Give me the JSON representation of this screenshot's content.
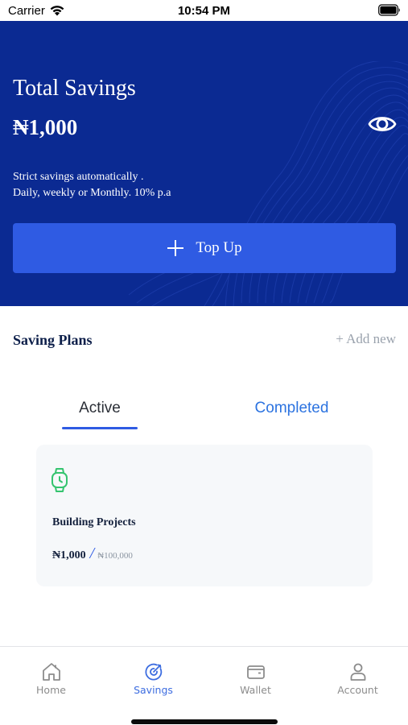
{
  "status_bar": {
    "carrier": "Carrier",
    "time": "10:54 PM",
    "wifi_icon": "wifi-icon",
    "battery_icon": "battery-full-icon"
  },
  "hero": {
    "title": "Total Savings",
    "amount": "₦1,000",
    "description_line1": "Strict savings automatically .",
    "description_line2": "Daily, weekly or Monthly. 10% p.a",
    "visibility_icon": "eye-icon",
    "topup_label": "Top Up",
    "topup_icon": "plus-icon",
    "background_color": "#0b2a92",
    "button_color": "#2f5be3"
  },
  "saving_plans": {
    "title": "Saving Plans",
    "add_new_label": "+ Add new",
    "tabs": [
      {
        "label": "Active",
        "selected": true
      },
      {
        "label": "Completed",
        "selected": false
      }
    ],
    "plans": [
      {
        "icon": "watch-icon",
        "name": "Building Projects",
        "saved": "₦1,000",
        "separator": "/",
        "target": "₦100,000"
      }
    ]
  },
  "bottom_nav": {
    "items": [
      {
        "label": "Home",
        "icon": "home-icon",
        "active": false
      },
      {
        "label": "Savings",
        "icon": "target-icon",
        "active": true
      },
      {
        "label": "Wallet",
        "icon": "wallet-icon",
        "active": false
      },
      {
        "label": "Account",
        "icon": "user-icon",
        "active": false
      }
    ],
    "active_color": "#3d6de0",
    "inactive_color": "#8c8c8c"
  }
}
